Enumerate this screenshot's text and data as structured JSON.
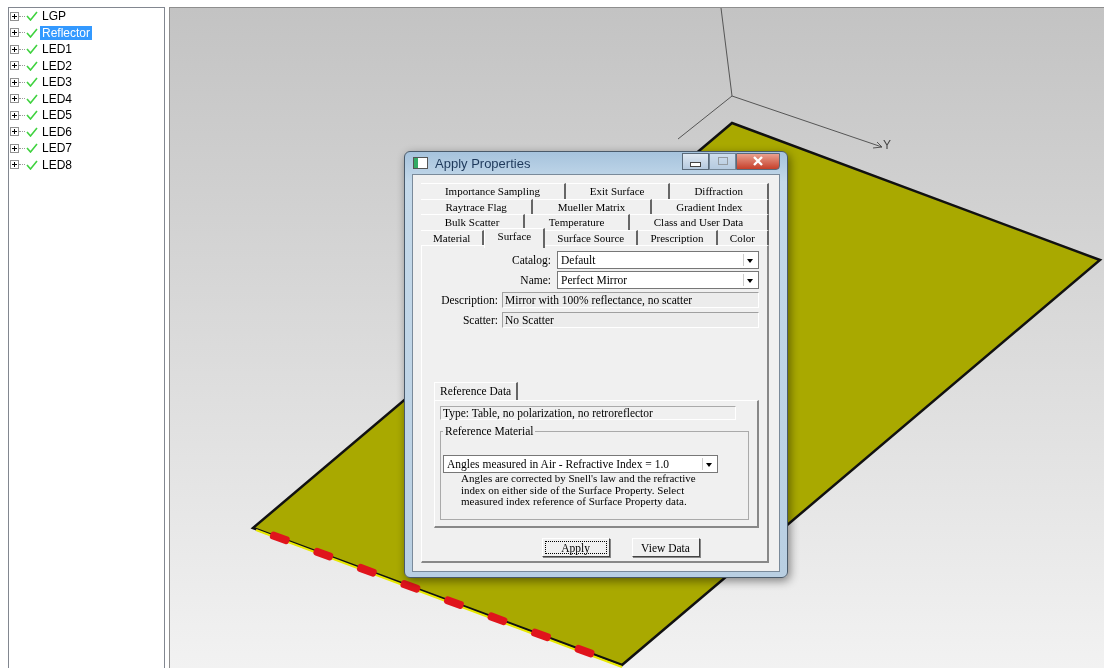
{
  "tree": {
    "items": [
      {
        "label": "LGP",
        "selected": false,
        "checked": true,
        "expanded": false
      },
      {
        "label": "Reflector",
        "selected": true,
        "checked": true,
        "expanded": false
      },
      {
        "label": "LED1",
        "selected": false,
        "checked": true,
        "expanded": false
      },
      {
        "label": "LED2",
        "selected": false,
        "checked": true,
        "expanded": false
      },
      {
        "label": "LED3",
        "selected": false,
        "checked": true,
        "expanded": false
      },
      {
        "label": "LED4",
        "selected": false,
        "checked": true,
        "expanded": false
      },
      {
        "label": "LED5",
        "selected": false,
        "checked": true,
        "expanded": false
      },
      {
        "label": "LED6",
        "selected": false,
        "checked": true,
        "expanded": false
      },
      {
        "label": "LED7",
        "selected": false,
        "checked": true,
        "expanded": false
      },
      {
        "label": "LED8",
        "selected": false,
        "checked": true,
        "expanded": false
      }
    ]
  },
  "viewport": {
    "axis_label": "Y"
  },
  "dialog": {
    "title": "Apply Properties",
    "tab_rows": [
      [
        {
          "label": "Importance Sampling",
          "selected": false
        },
        {
          "label": "Exit Surface",
          "selected": false
        },
        {
          "label": "Diffraction",
          "selected": false
        }
      ],
      [
        {
          "label": "Raytrace Flag",
          "selected": false
        },
        {
          "label": "Mueller Matrix",
          "selected": false
        },
        {
          "label": "Gradient Index",
          "selected": false
        }
      ],
      [
        {
          "label": "Bulk Scatter",
          "selected": false
        },
        {
          "label": "Temperature",
          "selected": false
        },
        {
          "label": "Class and User Data",
          "selected": false
        }
      ],
      [
        {
          "label": "Material",
          "selected": false
        },
        {
          "label": "Surface",
          "selected": true
        },
        {
          "label": "Surface Source",
          "selected": false
        },
        {
          "label": "Prescription",
          "selected": false
        },
        {
          "label": "Color",
          "selected": false
        }
      ]
    ],
    "fields": [
      {
        "kind": "dropdown",
        "label": "Catalog:",
        "value": "Default"
      },
      {
        "kind": "dropdown",
        "label": "Name:",
        "value": "Perfect Mirror"
      },
      {
        "kind": "readonly",
        "label": "Description:",
        "value": "Mirror with 100% reflectance, no scatter"
      },
      {
        "kind": "readonly",
        "label": "Scatter:",
        "value": "No Scatter"
      }
    ],
    "reference": {
      "tab": {
        "label": "Reference Data"
      },
      "type": "Type: Table, no polarization, no retroreflector",
      "group_title": "Reference Material",
      "dropdown_value": "Angles measured in Air - Refractive Index = 1.0",
      "help": "Angles are corrected by Snell's law and the refractive index on either side of the Surface Property.  Select measured index reference of Surface Property data."
    },
    "buttons": [
      {
        "label": "Apply",
        "focused": true
      },
      {
        "label": "View Data",
        "focused": false
      }
    ]
  }
}
